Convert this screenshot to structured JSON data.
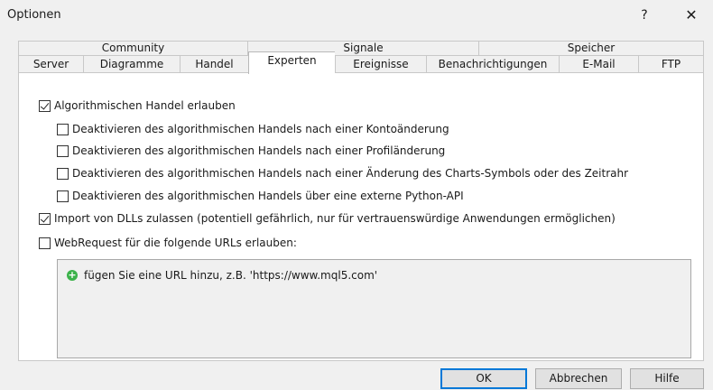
{
  "window": {
    "title": "Optionen",
    "help_glyph": "?",
    "close_glyph": "✕"
  },
  "tabs": {
    "row_top": [
      {
        "label": "Community"
      },
      {
        "label": "Signale"
      },
      {
        "label": "Speicher"
      }
    ],
    "row_bottom": [
      {
        "label": "Server"
      },
      {
        "label": "Diagramme"
      },
      {
        "label": "Handel"
      },
      {
        "label": "Experten",
        "active": true
      },
      {
        "label": "Ereignisse"
      },
      {
        "label": "Benachrichtigungen"
      },
      {
        "label": "E-Mail"
      },
      {
        "label": "FTP"
      }
    ]
  },
  "options": {
    "algo_trading": {
      "label": "Algorithmischen Handel erlauben",
      "checked": true
    },
    "sub": [
      {
        "label": "Deaktivieren des algorithmischen Handels nach einer Kontoänderung",
        "checked": false
      },
      {
        "label": "Deaktivieren des algorithmischen Handels nach einer Profiländerung",
        "checked": false
      },
      {
        "label": "Deaktivieren des algorithmischen Handels nach einer Änderung des Charts-Symbols oder des Zeitrahr",
        "checked": false
      },
      {
        "label": "Deaktivieren des algorithmischen Handels über eine externe Python-API",
        "checked": false
      }
    ],
    "dll_import": {
      "label": "Import von DLLs zulassen (potentiell gefährlich, nur für vertrauenswürdige Anwendungen ermöglichen)",
      "checked": true
    },
    "webrequest": {
      "label": "WebRequest für die folgende URLs erlauben:",
      "checked": false
    }
  },
  "url_list": {
    "add_label": "fügen Sie eine URL hinzu, z.B. 'https://www.mql5.com'",
    "add_icon": "plus-circle-icon"
  },
  "buttons": {
    "ok": "OK",
    "cancel": "Abbrechen",
    "help": "Hilfe"
  }
}
